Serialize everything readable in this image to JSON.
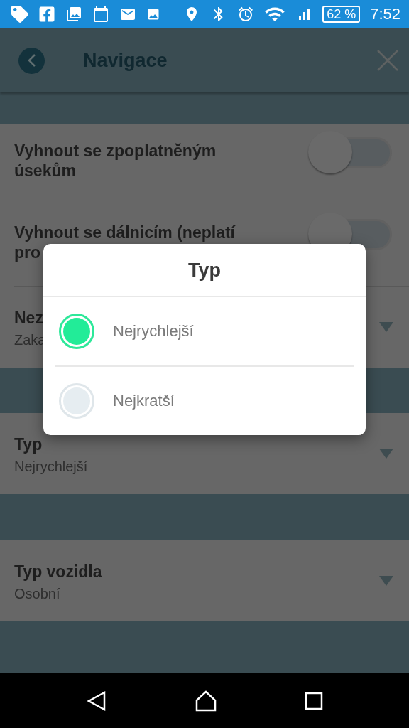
{
  "status_bar": {
    "battery": "62 %",
    "time": "7:52"
  },
  "header": {
    "title": "Navigace"
  },
  "sections": [
    {
      "rows": [
        {
          "kind": "toggle",
          "label_lines": [
            "Vyhnout se zpoplatněným",
            "úsekům"
          ],
          "on": false
        },
        {
          "kind": "toggle",
          "label_lines": [
            "Vyhnout se dálnicím (neplatí",
            "pro"
          ],
          "on": false
        },
        {
          "kind": "select",
          "label": "Nez",
          "value": "Zaka"
        }
      ]
    },
    {
      "rows": [
        {
          "kind": "select",
          "label": "Typ",
          "value": "Nejrychlejší"
        }
      ]
    },
    {
      "rows": [
        {
          "kind": "select",
          "label": "Typ vozidla",
          "value": "Osobní"
        }
      ]
    }
  ],
  "dialog": {
    "title": "Typ",
    "options": [
      {
        "label": "Nejrychlejší",
        "selected": true
      },
      {
        "label": "Nejkratší",
        "selected": false
      }
    ]
  }
}
